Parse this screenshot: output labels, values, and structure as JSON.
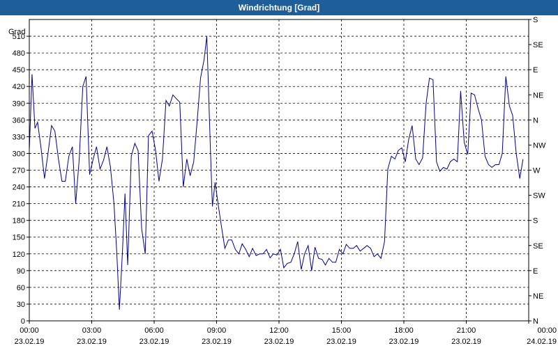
{
  "window": {
    "title": "Windrichtung [Grad]"
  },
  "chart_data": {
    "type": "line",
    "title": "Windrichtung [Grad]",
    "ylabel": "Grad",
    "ylim": [
      0,
      540
    ],
    "y_ticks": [
      0,
      30,
      60,
      90,
      120,
      150,
      180,
      210,
      240,
      270,
      300,
      330,
      360,
      390,
      420,
      450,
      480,
      510
    ],
    "right_axis_labels": [
      {
        "value": 0,
        "label": "N"
      },
      {
        "value": 30,
        "label": "NE"
      },
      {
        "value": 60,
        "label": "E"
      },
      {
        "value": 90,
        "label": "SE"
      },
      {
        "value": 120,
        "label": "S"
      },
      {
        "value": 150,
        "label": "SW"
      },
      {
        "value": 180,
        "label": "W"
      },
      {
        "value": 210,
        "label": "NW"
      },
      {
        "value": 240,
        "label": "N"
      },
      {
        "value": 270,
        "label": "NE"
      },
      {
        "value": 300,
        "label": "E"
      },
      {
        "value": 330,
        "label": "SE"
      },
      {
        "value": 360,
        "label": "S"
      }
    ],
    "xlim_hours": [
      0,
      24
    ],
    "x_ticks": [
      {
        "hour": 0,
        "time": "00:00",
        "date": "23.02.19"
      },
      {
        "hour": 3,
        "time": "03:00",
        "date": "23.02.19"
      },
      {
        "hour": 6,
        "time": "06:00",
        "date": "23.02.19"
      },
      {
        "hour": 9,
        "time": "09:00",
        "date": "23.02.19"
      },
      {
        "hour": 12,
        "time": "12:00",
        "date": "23.02.19"
      },
      {
        "hour": 15,
        "time": "15:00",
        "date": "23.02.19"
      },
      {
        "hour": 18,
        "time": "18:00",
        "date": "23.02.19"
      },
      {
        "hour": 21,
        "time": "21:00",
        "date": "23.02.19"
      },
      {
        "hour": 24,
        "time": "00:00",
        "date": "24.02.19"
      }
    ],
    "grid": true,
    "line_color": "#00008b",
    "series": [
      {
        "points": [
          [
            0.0,
            305
          ],
          [
            0.13,
            442
          ],
          [
            0.27,
            345
          ],
          [
            0.4,
            356
          ],
          [
            0.57,
            308
          ],
          [
            0.73,
            255
          ],
          [
            0.9,
            300
          ],
          [
            1.07,
            350
          ],
          [
            1.23,
            340
          ],
          [
            1.4,
            290
          ],
          [
            1.57,
            250
          ],
          [
            1.73,
            250
          ],
          [
            1.9,
            295
          ],
          [
            2.07,
            312
          ],
          [
            2.23,
            210
          ],
          [
            2.4,
            290
          ],
          [
            2.57,
            420
          ],
          [
            2.73,
            438
          ],
          [
            2.9,
            262
          ],
          [
            3.07,
            290
          ],
          [
            3.23,
            312
          ],
          [
            3.4,
            272
          ],
          [
            3.57,
            288
          ],
          [
            3.73,
            312
          ],
          [
            3.9,
            275
          ],
          [
            4.07,
            210
          ],
          [
            4.2,
            125
          ],
          [
            4.33,
            20
          ],
          [
            4.47,
            120
          ],
          [
            4.6,
            228
          ],
          [
            4.73,
            100
          ],
          [
            4.9,
            295
          ],
          [
            5.07,
            318
          ],
          [
            5.23,
            305
          ],
          [
            5.4,
            165
          ],
          [
            5.57,
            120
          ],
          [
            5.73,
            332
          ],
          [
            5.9,
            340
          ],
          [
            6.07,
            305
          ],
          [
            6.23,
            250
          ],
          [
            6.4,
            290
          ],
          [
            6.57,
            395
          ],
          [
            6.73,
            385
          ],
          [
            6.9,
            405
          ],
          [
            7.07,
            398
          ],
          [
            7.23,
            392
          ],
          [
            7.4,
            240
          ],
          [
            7.57,
            290
          ],
          [
            7.73,
            260
          ],
          [
            7.9,
            285
          ],
          [
            8.07,
            360
          ],
          [
            8.23,
            435
          ],
          [
            8.4,
            468
          ],
          [
            8.53,
            510
          ],
          [
            8.7,
            310
          ],
          [
            8.8,
            205
          ],
          [
            8.93,
            248
          ],
          [
            9.07,
            210
          ],
          [
            9.23,
            170
          ],
          [
            9.4,
            130
          ],
          [
            9.57,
            145
          ],
          [
            9.73,
            145
          ],
          [
            9.9,
            128
          ],
          [
            10.07,
            120
          ],
          [
            10.23,
            138
          ],
          [
            10.4,
            128
          ],
          [
            10.57,
            115
          ],
          [
            10.73,
            130
          ],
          [
            10.9,
            117
          ],
          [
            11.07,
            120
          ],
          [
            11.23,
            120
          ],
          [
            11.4,
            128
          ],
          [
            11.57,
            113
          ],
          [
            11.73,
            120
          ],
          [
            11.9,
            118
          ],
          [
            12.07,
            128
          ],
          [
            12.23,
            95
          ],
          [
            12.4,
            103
          ],
          [
            12.57,
            105
          ],
          [
            12.73,
            120
          ],
          [
            12.9,
            142
          ],
          [
            13.07,
            92
          ],
          [
            13.23,
            120
          ],
          [
            13.4,
            135
          ],
          [
            13.57,
            90
          ],
          [
            13.73,
            132
          ],
          [
            13.9,
            112
          ],
          [
            14.07,
            110
          ],
          [
            14.23,
            100
          ],
          [
            14.4,
            112
          ],
          [
            14.57,
            105
          ],
          [
            14.73,
            105
          ],
          [
            14.9,
            128
          ],
          [
            15.07,
            120
          ],
          [
            15.23,
            137
          ],
          [
            15.4,
            130
          ],
          [
            15.57,
            130
          ],
          [
            15.73,
            135
          ],
          [
            15.9,
            125
          ],
          [
            16.07,
            130
          ],
          [
            16.23,
            135
          ],
          [
            16.4,
            130
          ],
          [
            16.57,
            115
          ],
          [
            16.73,
            120
          ],
          [
            16.9,
            112
          ],
          [
            17.07,
            142
          ],
          [
            17.23,
            272
          ],
          [
            17.4,
            295
          ],
          [
            17.57,
            290
          ],
          [
            17.73,
            305
          ],
          [
            17.9,
            310
          ],
          [
            18.07,
            285
          ],
          [
            18.23,
            325
          ],
          [
            18.4,
            350
          ],
          [
            18.57,
            290
          ],
          [
            18.73,
            280
          ],
          [
            18.9,
            292
          ],
          [
            19.07,
            390
          ],
          [
            19.23,
            435
          ],
          [
            19.4,
            432
          ],
          [
            19.57,
            285
          ],
          [
            19.73,
            268
          ],
          [
            19.9,
            275
          ],
          [
            20.07,
            272
          ],
          [
            20.23,
            285
          ],
          [
            20.4,
            290
          ],
          [
            20.57,
            285
          ],
          [
            20.73,
            412
          ],
          [
            20.9,
            320
          ],
          [
            21.07,
            298
          ],
          [
            21.23,
            408
          ],
          [
            21.4,
            405
          ],
          [
            21.57,
            380
          ],
          [
            21.73,
            360
          ],
          [
            21.9,
            295
          ],
          [
            22.07,
            280
          ],
          [
            22.23,
            275
          ],
          [
            22.4,
            280
          ],
          [
            22.57,
            280
          ],
          [
            22.73,
            300
          ],
          [
            22.9,
            438
          ],
          [
            23.07,
            385
          ],
          [
            23.23,
            368
          ],
          [
            23.4,
            300
          ],
          [
            23.57,
            255
          ],
          [
            23.73,
            290
          ]
        ]
      }
    ]
  }
}
